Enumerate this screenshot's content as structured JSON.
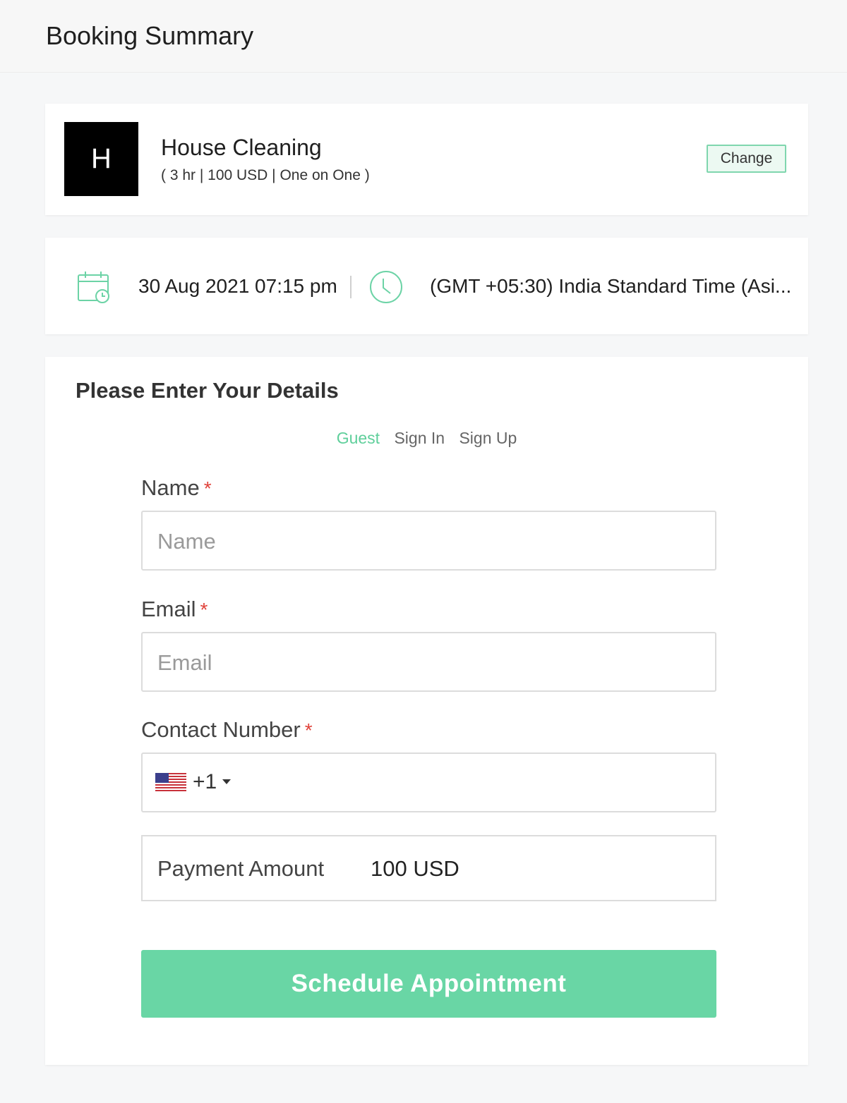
{
  "header": {
    "title": "Booking Summary"
  },
  "service": {
    "logo_letter": "H",
    "name": "House Cleaning",
    "meta": "( 3 hr | 100 USD | One on One )",
    "change_label": "Change"
  },
  "schedule": {
    "datetime": "30 Aug 2021 07:15 pm",
    "timezone": "(GMT +05:30) India Standard Time (Asi..."
  },
  "form": {
    "heading": "Please Enter Your Details",
    "tabs": [
      {
        "label": "Guest",
        "active": true
      },
      {
        "label": "Sign In",
        "active": false
      },
      {
        "label": "Sign Up",
        "active": false
      }
    ],
    "name": {
      "label": "Name",
      "required": "*",
      "placeholder": "Name"
    },
    "email": {
      "label": "Email",
      "required": "*",
      "placeholder": "Email"
    },
    "contact": {
      "label": "Contact Number",
      "required": "*",
      "country_code": "+1"
    },
    "payment": {
      "label": "Payment Amount",
      "value": "100 USD"
    },
    "submit_label": "Schedule Appointment"
  },
  "colors": {
    "accent": "#69d6a5",
    "required": "#e0433b",
    "tab_active": "#5fcf9b"
  }
}
